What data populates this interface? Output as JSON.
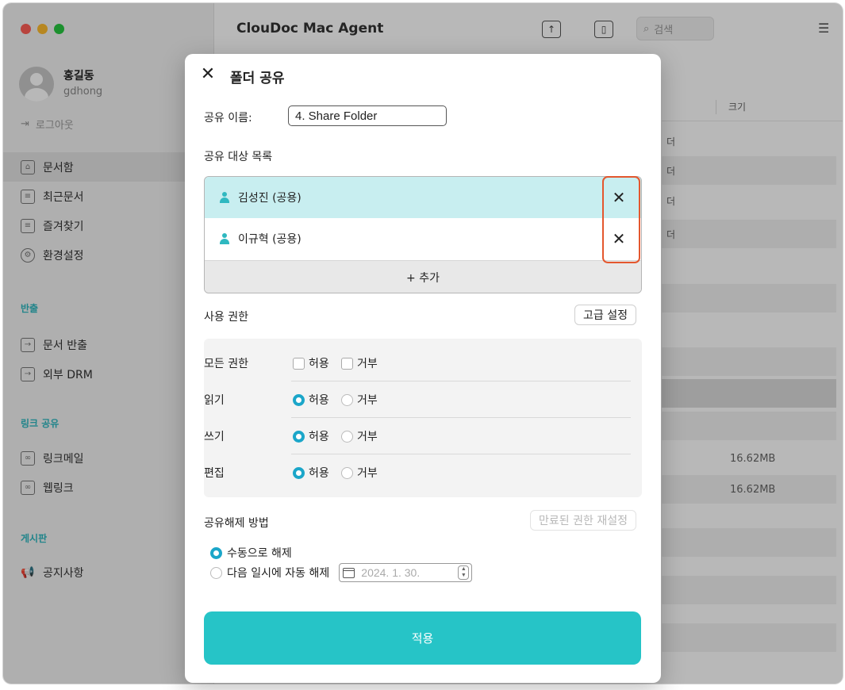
{
  "app": {
    "title": "ClouDoc Mac Agent",
    "search_placeholder": "검색"
  },
  "profile": {
    "name": "홍길동",
    "id": "gdhong",
    "logout": "로그아웃"
  },
  "sidebar": {
    "main_items": [
      {
        "label": "문서함",
        "icon": "folder-icon",
        "active": true
      },
      {
        "label": "최근문서",
        "icon": "recent-doc-icon",
        "active": false
      },
      {
        "label": "즐겨찾기",
        "icon": "favorite-doc-icon",
        "active": false
      },
      {
        "label": "환경설정",
        "icon": "gear-icon",
        "active": false
      }
    ],
    "sections": [
      {
        "title": "반출",
        "items": [
          {
            "label": "문서 반출",
            "icon": "export-doc-icon"
          },
          {
            "label": "외부 DRM",
            "icon": "external-drm-icon"
          }
        ]
      },
      {
        "title": "링크 공유",
        "items": [
          {
            "label": "링크메일",
            "icon": "link-mail-icon"
          },
          {
            "label": "웹링크",
            "icon": "web-link-icon"
          }
        ]
      },
      {
        "title": "게시판",
        "items": [
          {
            "label": "공지사항",
            "icon": "megaphone-icon"
          }
        ]
      }
    ]
  },
  "file_list": {
    "column_size": "크기",
    "row_fragments": [
      "더",
      "더",
      "더",
      "더"
    ],
    "sizes": [
      "16.62MB",
      "16.62MB"
    ]
  },
  "dialog": {
    "title": "폴더 공유",
    "share_name_label": "공유 이름:",
    "share_name_value": "4. Share Folder",
    "targets_title": "공유 대상 목록",
    "targets": [
      {
        "name": "김성진 (공용)",
        "selected": true
      },
      {
        "name": "이규혁 (공용)",
        "selected": false
      }
    ],
    "add_label": "+ 추가",
    "permissions_title": "사용 권한",
    "advanced_button": "고급 설정",
    "allow_label": "허용",
    "deny_label": "거부",
    "permissions": [
      {
        "name": "모든 권한",
        "type": "checkbox",
        "allow": false,
        "deny": false
      },
      {
        "name": "읽기",
        "type": "radio",
        "allow": true,
        "deny": false
      },
      {
        "name": "쓰기",
        "type": "radio",
        "allow": true,
        "deny": false
      },
      {
        "name": "편집",
        "type": "radio",
        "allow": true,
        "deny": false
      }
    ],
    "unshare_title": "공유해제 방법",
    "reset_button": "만료된 권한 재설정",
    "unshare_options": [
      {
        "label": "수동으로 해제",
        "selected": true
      },
      {
        "label": "다음 일시에 자동 해제",
        "selected": false
      }
    ],
    "date_value": "2024.  1. 30.",
    "apply_button": "적용"
  },
  "colors": {
    "accent": "#26c4c7",
    "selected_row": "#c8eef0",
    "highlight": "#e4572e",
    "section_title": "#2fb8c0"
  }
}
